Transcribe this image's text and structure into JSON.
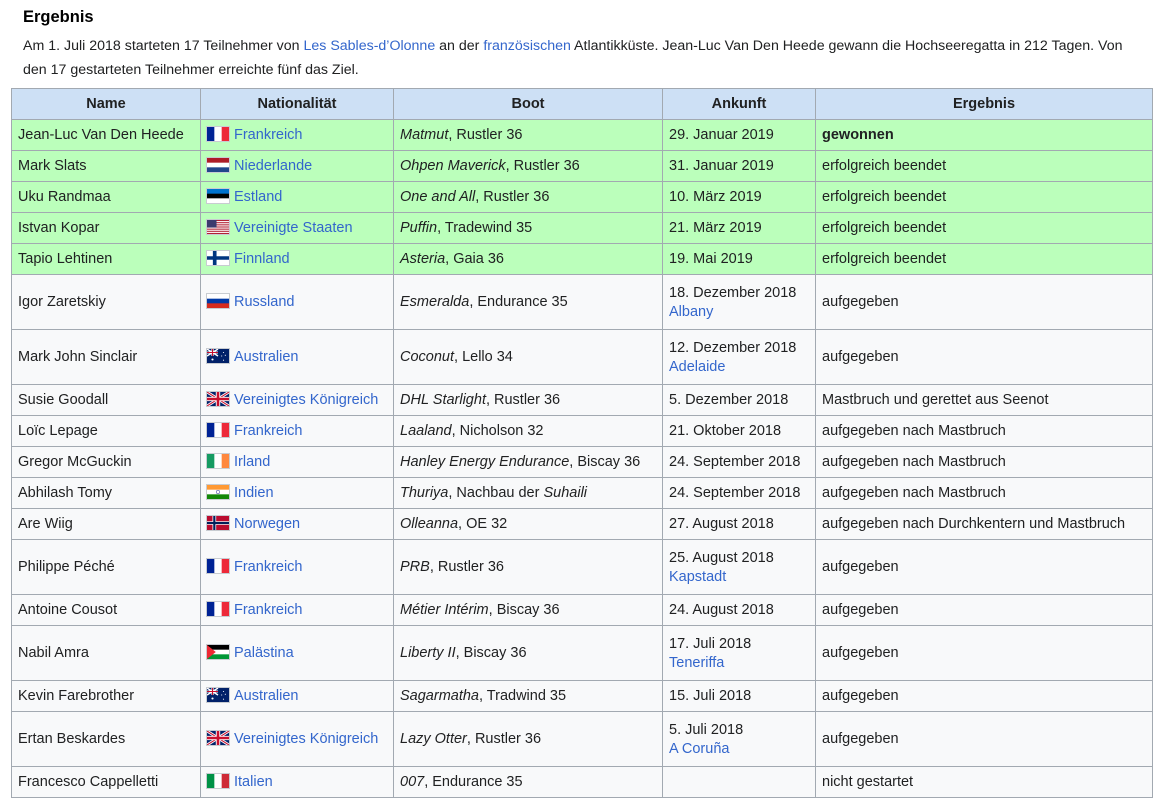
{
  "section": {
    "title": "Ergebnis",
    "intro_parts": [
      {
        "text": "Am 1. Juli 2018 starteten 17 Teilnehmer von ",
        "link": false
      },
      {
        "text": "Les Sables-d’Olonne",
        "link": true
      },
      {
        "text": " an der ",
        "link": false
      },
      {
        "text": "französischen",
        "link": true
      },
      {
        "text": " Atlantikküste. Jean-Luc Van Den Heede gewann die Hochseeregatta in 212 Tagen. Von den 17 gestarteten Teilnehmer erreichte fünf das Ziel.",
        "link": false
      }
    ]
  },
  "table": {
    "headers": [
      "Name",
      "Nationalität",
      "Boot",
      "Ankunft",
      "Ergebnis"
    ],
    "rows": [
      {
        "name": "Jean-Luc Van Den Heede",
        "flag": "fr",
        "nation": "Frankreich",
        "boat": "Matmut",
        "model": ", Rustler 36",
        "arrival": "29. Januar 2019",
        "place": "",
        "result": "gewonnen",
        "finished": true,
        "bold": true
      },
      {
        "name": "Mark Slats",
        "flag": "nl",
        "nation": "Niederlande",
        "boat": "Ohpen Maverick",
        "model": ", Rustler 36",
        "arrival": "31. Januar 2019",
        "place": "",
        "result": "erfolgreich beendet",
        "finished": true
      },
      {
        "name": "Uku Randmaa",
        "flag": "ee",
        "nation": "Estland",
        "boat": "One and All",
        "model": ", Rustler 36",
        "arrival": "10. März 2019",
        "place": "",
        "result": "erfolgreich beendet",
        "finished": true
      },
      {
        "name": "Istvan Kopar",
        "flag": "us",
        "nation": "Vereinigte Staaten",
        "boat": "Puffin",
        "model": ", Tradewind 35",
        "arrival": "21. März 2019",
        "place": "",
        "result": "erfolgreich beendet",
        "finished": true
      },
      {
        "name": "Tapio Lehtinen",
        "flag": "fi",
        "nation": "Finnland",
        "boat": "Asteria",
        "model": ", Gaia 36",
        "arrival": "19. Mai 2019",
        "place": "",
        "result": "erfolgreich beendet",
        "finished": true
      },
      {
        "name": "Igor Zaretskiy",
        "flag": "ru",
        "nation": "Russland",
        "boat": "Esmeralda",
        "model": ", Endurance 35",
        "arrival": "18. Dezember 2018",
        "place": "Albany",
        "result": "aufgegeben",
        "finished": false
      },
      {
        "name": "Mark John Sinclair",
        "flag": "au",
        "nation": "Australien",
        "boat": "Coconut",
        "model": ", Lello 34",
        "arrival": "12. Dezember 2018",
        "place": "Adelaide",
        "result": "aufgegeben",
        "finished": false
      },
      {
        "name": "Susie Goodall",
        "flag": "gb",
        "nation": "Vereinigtes Königreich",
        "boat": "DHL Starlight",
        "model": ", Rustler 36",
        "arrival": "5. Dezember 2018",
        "place": "",
        "result": "Mastbruch und gerettet aus Seenot",
        "finished": false
      },
      {
        "name": "Loïc Lepage",
        "flag": "fr",
        "nation": "Frankreich",
        "boat": "Laaland",
        "model": ", Nicholson 32",
        "arrival": "21. Oktober 2018",
        "place": "",
        "result": "aufgegeben nach Mastbruch",
        "finished": false
      },
      {
        "name": "Gregor McGuckin",
        "flag": "ie",
        "nation": "Irland",
        "boat": "Hanley Energy Endurance",
        "model": ", Biscay 36",
        "arrival": "24. September 2018",
        "place": "",
        "result": "aufgegeben nach Mastbruch",
        "finished": false
      },
      {
        "name": "Abhilash Tomy",
        "flag": "in",
        "nation": "Indien",
        "boat": "Thuriya",
        "model": ", Nachbau der ",
        "model_italic": "Suhaili",
        "arrival": "24. September 2018",
        "place": "",
        "result": "aufgegeben nach Mastbruch",
        "finished": false
      },
      {
        "name": "Are Wiig",
        "flag": "no",
        "nation": "Norwegen",
        "boat": "Olleanna",
        "model": ", OE 32",
        "arrival": "27. August 2018",
        "place": "",
        "result": "aufgegeben nach Durchkentern und Mastbruch",
        "finished": false
      },
      {
        "name": "Philippe Péché",
        "flag": "fr",
        "nation": "Frankreich",
        "boat": "PRB",
        "model": ", Rustler 36",
        "arrival": "25. August 2018",
        "place": "Kapstadt",
        "result": "aufgegeben",
        "finished": false
      },
      {
        "name": "Antoine Cousot",
        "flag": "fr",
        "nation": "Frankreich",
        "boat": "Métier Intérim",
        "model": ", Biscay 36",
        "arrival": "24. August 2018",
        "place": "",
        "result": "aufgegeben",
        "finished": false
      },
      {
        "name": "Nabil Amra",
        "flag": "ps",
        "nation": "Palästina",
        "boat": "Liberty II",
        "model": ", Biscay 36",
        "arrival": "17. Juli 2018",
        "place": "Teneriffa",
        "result": "aufgegeben",
        "finished": false
      },
      {
        "name": "Kevin Farebrother",
        "flag": "au",
        "nation": "Australien",
        "boat": "Sagarmatha",
        "model": ", Tradwind 35",
        "arrival": "15. Juli 2018",
        "place": "",
        "result": "aufgegeben",
        "finished": false
      },
      {
        "name": "Ertan Beskardes",
        "flag": "gb",
        "nation": "Vereinigtes Königreich",
        "boat": "Lazy Otter",
        "model": ", Rustler 36",
        "arrival": "5. Juli 2018",
        "place": "A Coruña",
        "result": "aufgegeben",
        "finished": false
      },
      {
        "name": "Francesco Cappelletti",
        "flag": "it",
        "nation": "Italien",
        "boat": "007",
        "model": ", Endurance 35",
        "arrival": "",
        "place": "",
        "result": "nicht gestartet",
        "finished": false
      }
    ]
  },
  "colors": {
    "link": "#3366cc",
    "header_bg": "#cde0f5",
    "finished_bg": "#bbffbb",
    "row_bg": "#f8f9fa",
    "border": "#a2a9b1"
  }
}
